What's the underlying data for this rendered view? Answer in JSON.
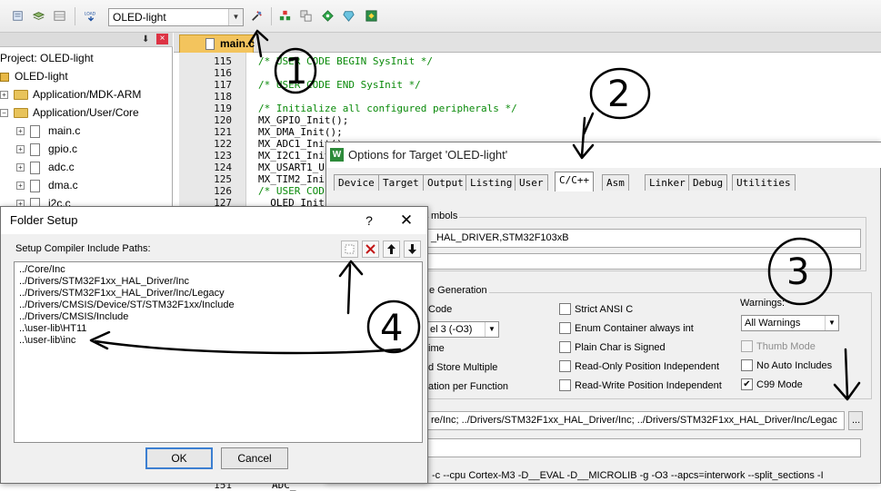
{
  "toolbar": {
    "target_name": "OLED-light",
    "icons": [
      "new-file-icon",
      "save-all-icon",
      "stack-icon",
      "grid-icon",
      "load-icon",
      "target-options-icon",
      "manage-project-icon",
      "copy-icon",
      "diamond-icon",
      "pack-installer-icon"
    ],
    "load_label": "LOAD"
  },
  "project": {
    "header_pin": "⬇",
    "items": [
      {
        "label": "Project: OLED-light"
      },
      {
        "label": "OLED-light"
      },
      {
        "label": "Application/MDK-ARM"
      },
      {
        "label": "Application/User/Core"
      },
      {
        "label": "main.c"
      },
      {
        "label": "gpio.c"
      },
      {
        "label": "adc.c"
      },
      {
        "label": "dma.c"
      },
      {
        "label": "i2c.c"
      }
    ]
  },
  "editor": {
    "active_tab": "main.c",
    "lines": [
      {
        "num": "115",
        "code": "/* USER CODE BEGIN SysInit */",
        "comment": true
      },
      {
        "num": "116",
        "code": "",
        "comment": false
      },
      {
        "num": "117",
        "code": "/* USER CODE END SysInit */",
        "comment": true
      },
      {
        "num": "118",
        "code": "",
        "comment": false
      },
      {
        "num": "119",
        "code": "/* Initialize all configured peripherals */",
        "comment": true
      },
      {
        "num": "120",
        "code": "MX_GPIO_Init();",
        "comment": false
      },
      {
        "num": "121",
        "code": "MX_DMA_Init();",
        "comment": false
      },
      {
        "num": "122",
        "code": "MX_ADC1_Init();",
        "comment": false
      },
      {
        "num": "123",
        "code": "MX_I2C1_Init();",
        "comment": false
      },
      {
        "num": "124",
        "code": "MX_USART1_U",
        "comment": false
      },
      {
        "num": "125",
        "code": "MX_TIM2_Ini",
        "comment": false
      },
      {
        "num": "126",
        "code": "/* USER COD",
        "comment": true
      },
      {
        "num": "127",
        "code": "  OLED_Init",
        "comment": false
      }
    ],
    "bottom_line_num": "151",
    "bottom_line_code": "ADC_"
  },
  "options": {
    "title": "Options for Target 'OLED-light'",
    "tabs": [
      "Device",
      "Target",
      "Output",
      "Listing",
      "User",
      "C/C++",
      "Asm",
      "Linker",
      "Debug",
      "Utilities"
    ],
    "active_tab": "C/C++",
    "define_group": "mbols",
    "define_value": "_HAL_DRIVER,STM32F103xB",
    "codegen_group": "e Generation",
    "left_options": [
      "Code",
      "el 3 (-O3)",
      "ime",
      "d Store Multiple",
      "ation per Function"
    ],
    "mid_options": [
      {
        "label": "Strict ANSI C",
        "checked": false
      },
      {
        "label": "Enum Container always int",
        "checked": false
      },
      {
        "label": "Plain Char is Signed",
        "checked": false
      },
      {
        "label": "Read-Only Position Independent",
        "checked": false
      },
      {
        "label": "Read-Write Position Independent",
        "checked": false
      }
    ],
    "warnings_label": "Warnings:",
    "warnings_value": "All Warnings",
    "right_options": [
      {
        "label": "Thumb Mode",
        "checked": false,
        "disabled": true
      },
      {
        "label": "No Auto Includes",
        "checked": false,
        "disabled": false
      },
      {
        "label": "C99 Mode",
        "checked": true,
        "disabled": false
      }
    ],
    "include_paths_value": "re/Inc;  ../Drivers/STM32F1xx_HAL_Driver/Inc;  ../Drivers/STM32F1xx_HAL_Driver/Inc/Legac",
    "browse_label": "...",
    "compiler_string": "-c --cpu Cortex-M3 -D__EVAL -D__MICROLIB -g -O3 --apcs=interwork --split_sections -I"
  },
  "folder_setup": {
    "title": "Folder Setup",
    "help": "?",
    "close": "✕",
    "label": "Setup Compiler Include Paths:",
    "paths": [
      "../Core/Inc",
      "../Drivers/STM32F1xx_HAL_Driver/Inc",
      "../Drivers/STM32F1xx_HAL_Driver/Inc/Legacy",
      "../Drivers/CMSIS/Device/ST/STM32F1xx/Include",
      "../Drivers/CMSIS/Include",
      "..\\user-lib\\HT11",
      "..\\user-lib\\inc"
    ],
    "ok": "OK",
    "cancel": "Cancel"
  },
  "annotations": [
    "1",
    "2",
    "3",
    "4"
  ]
}
